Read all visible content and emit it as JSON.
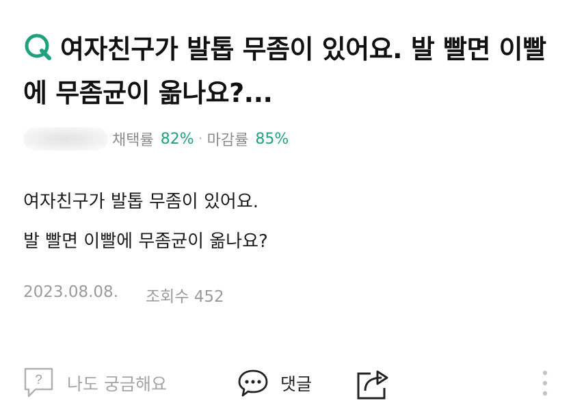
{
  "question": {
    "title": "여자친구가 발톱 무좀이 있어요. 발 빨면 이빨에 무좀균이 옮나요?...",
    "body_lines": [
      "여자친구가 발톱 무좀이 있어요.",
      "발 빨면 이빨에 무좀균이 옮나요?"
    ],
    "date": "2023.08.08.",
    "views": "조회수 452"
  },
  "author": {
    "adoption_label": "채택률",
    "adoption_value": "82%",
    "separator": "·",
    "deadline_label": "마감률",
    "deadline_value": "85%"
  },
  "actions": {
    "curious_label": "나도 궁금해요",
    "comment_label": "댓글"
  },
  "colors": {
    "brand_green": "#1fa27c",
    "muted_text": "#9a9a9a"
  },
  "icons": {
    "question": "q-badge-icon",
    "curious": "question-box-icon",
    "comment": "speech-bubble-icon",
    "share": "share-icon",
    "more": "more-vertical-icon"
  }
}
